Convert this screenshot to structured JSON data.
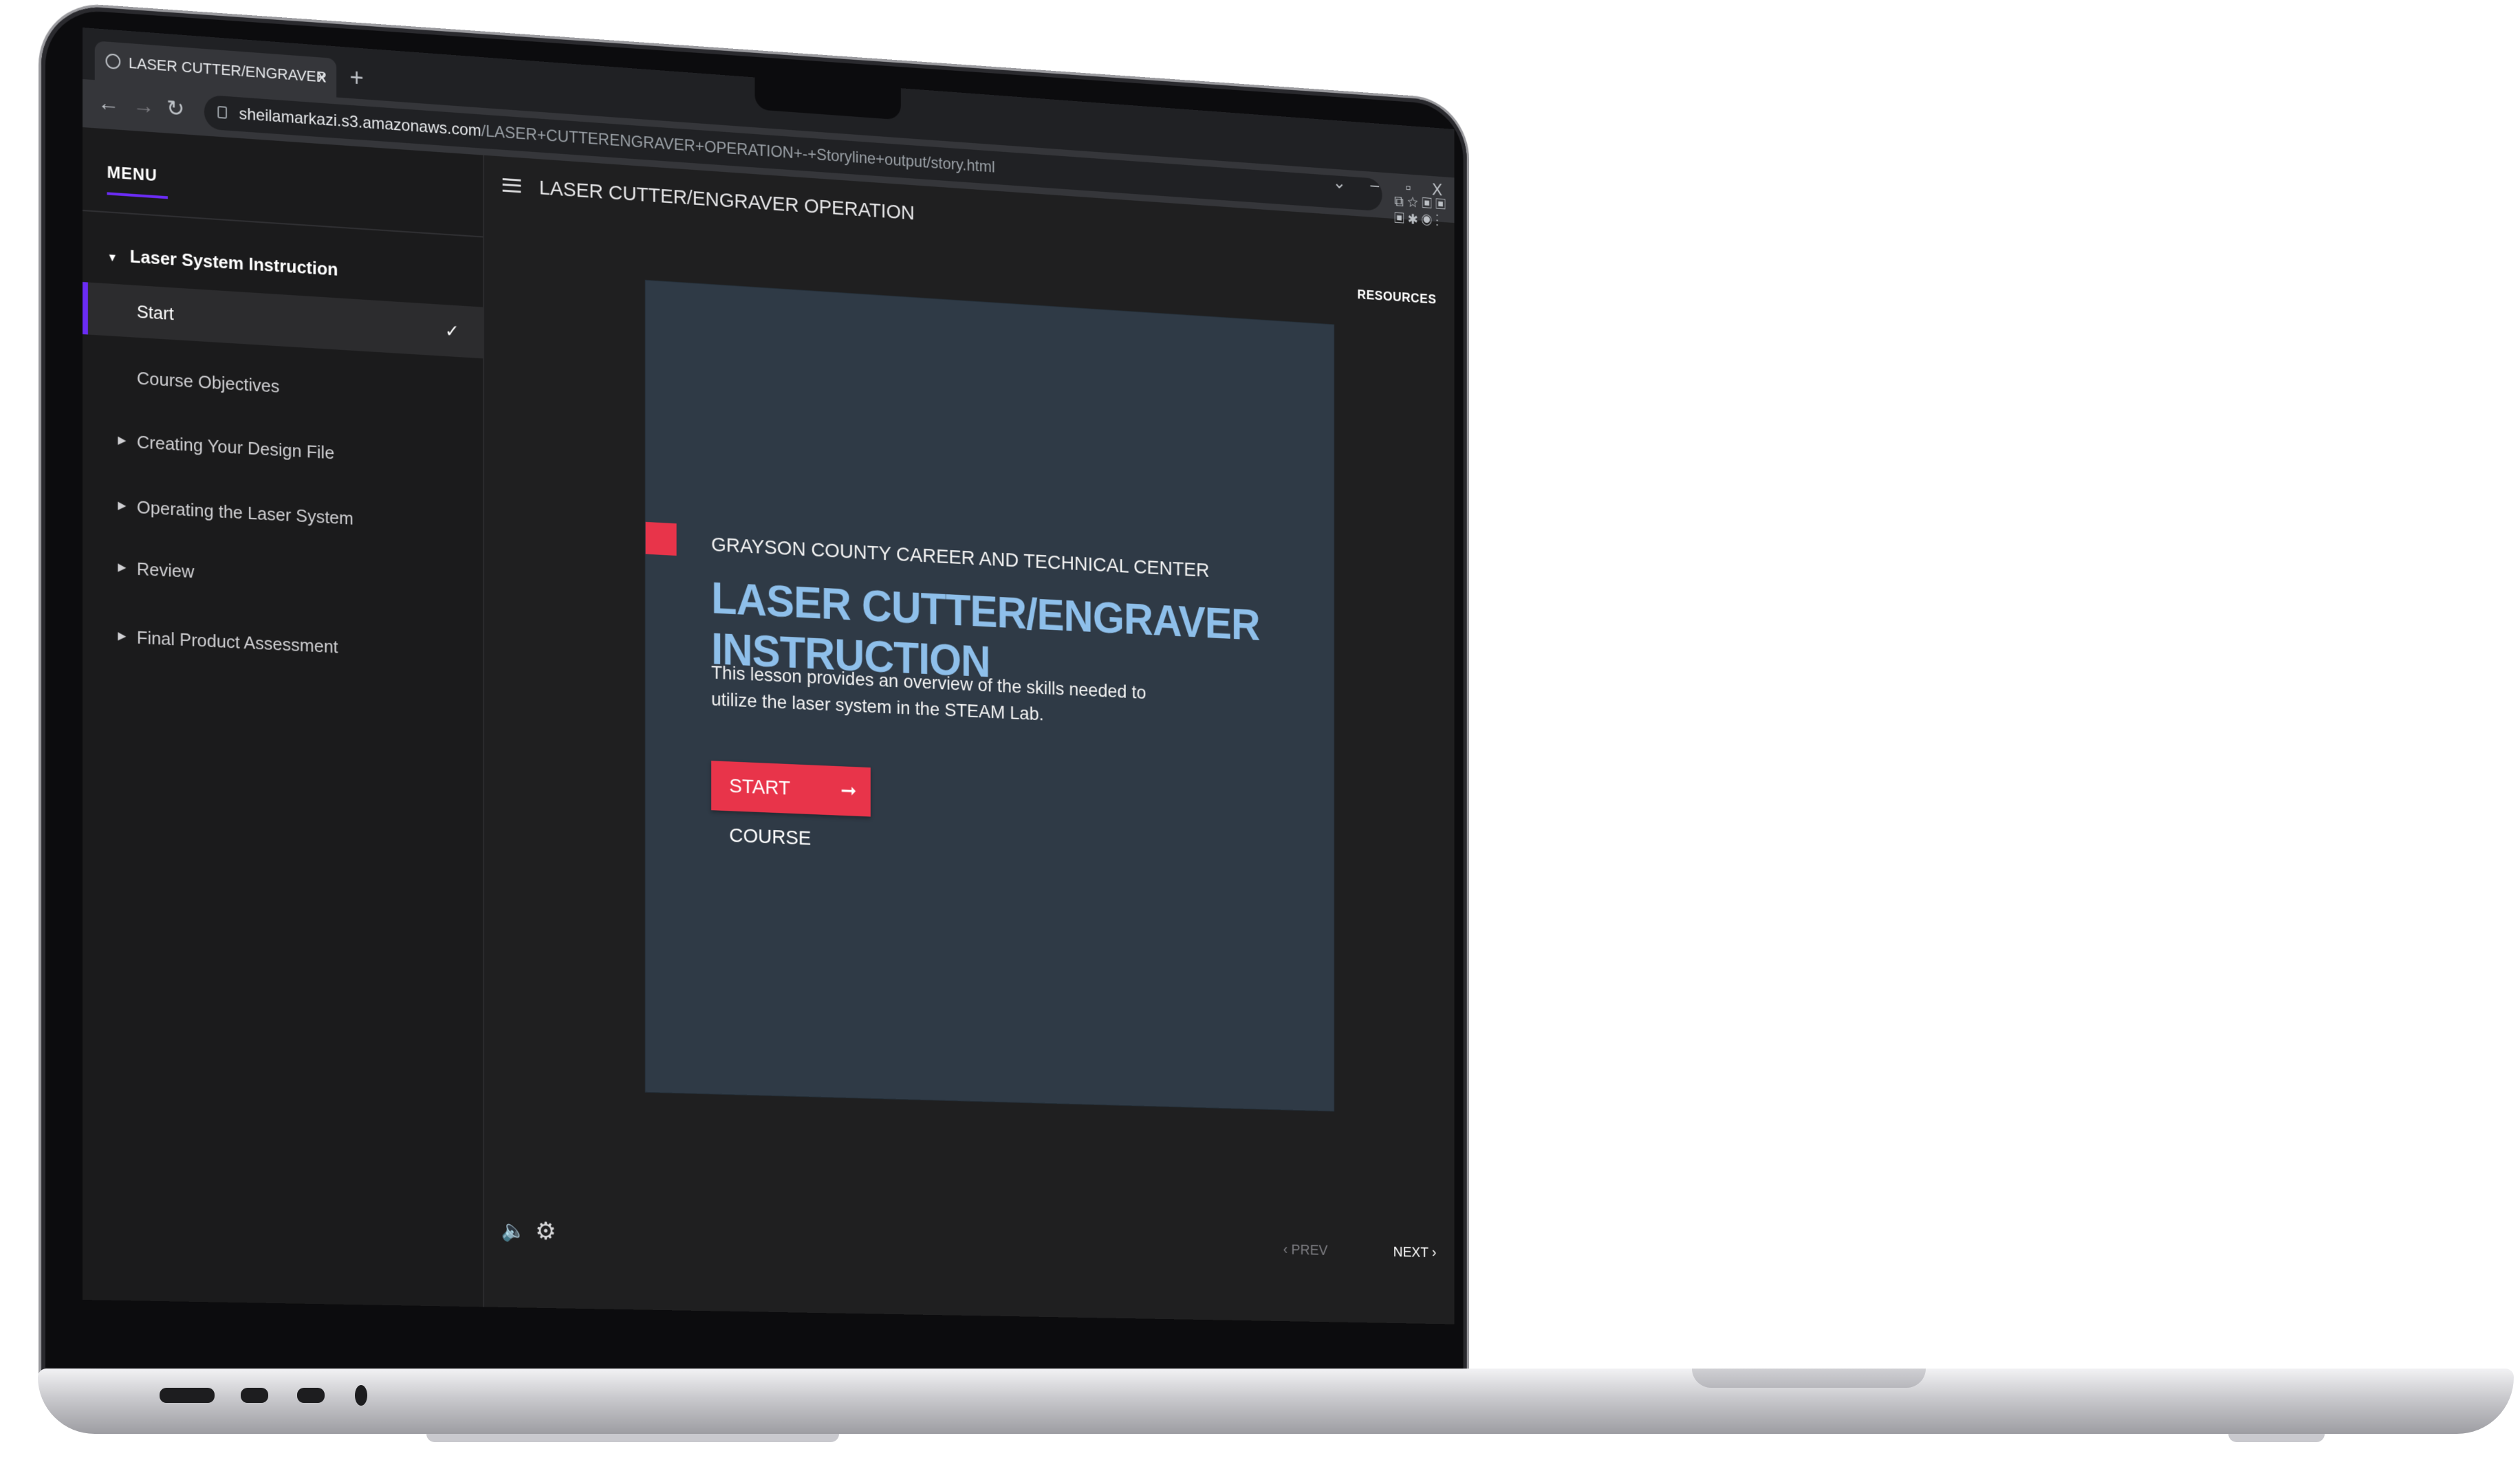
{
  "browser": {
    "tab_title": "LASER CUTTER/ENGRAVER OPER",
    "tab_close": "x",
    "new_tab": "+",
    "url_domain": "sheilamarkazi.s3.amazonaws.com",
    "url_path": "/LASER+CUTTERENGRAVER+OPERATION+-+Storyline+output/story.html",
    "window_controls": {
      "dropdown": "⌄",
      "minimize": "–",
      "restore": "▫",
      "close": "X"
    },
    "extension_icons": "⧉ ☆ ▣ ▣ ▣ ✱ ◉ ⋮"
  },
  "player": {
    "course_title": "LASER CUTTER/ENGRAVER OPERATION",
    "menu_label": "MENU",
    "resources_label": "RESOURCES",
    "section_title": "Laser System Instruction",
    "nav_items": [
      {
        "label": "Start",
        "active": true,
        "checked": true
      },
      {
        "label": "Course Objectives"
      },
      {
        "label": "Creating Your Design File",
        "expandable": true
      },
      {
        "label": "Operating the Laser System",
        "expandable": true
      },
      {
        "label": "Review",
        "expandable": true
      },
      {
        "label": "Final Product Assessment",
        "expandable": true
      }
    ],
    "prev_label": "PREV",
    "next_label": "NEXT"
  },
  "slide": {
    "organization": "GRAYSON COUNTY CAREER AND TECHNICAL CENTER",
    "headline": "LASER CUTTER/ENGRAVER INSTRUCTION",
    "description": "This lesson provides an overview of the skills needed to utilize the laser system in the STEAM Lab.",
    "start_button": "START COURSE"
  },
  "colors": {
    "accent_red": "#e8344a",
    "headline_blue": "#8ebfea",
    "active_indicator_purple": "#6b2cf5",
    "slide_background": "#2f3a46"
  }
}
